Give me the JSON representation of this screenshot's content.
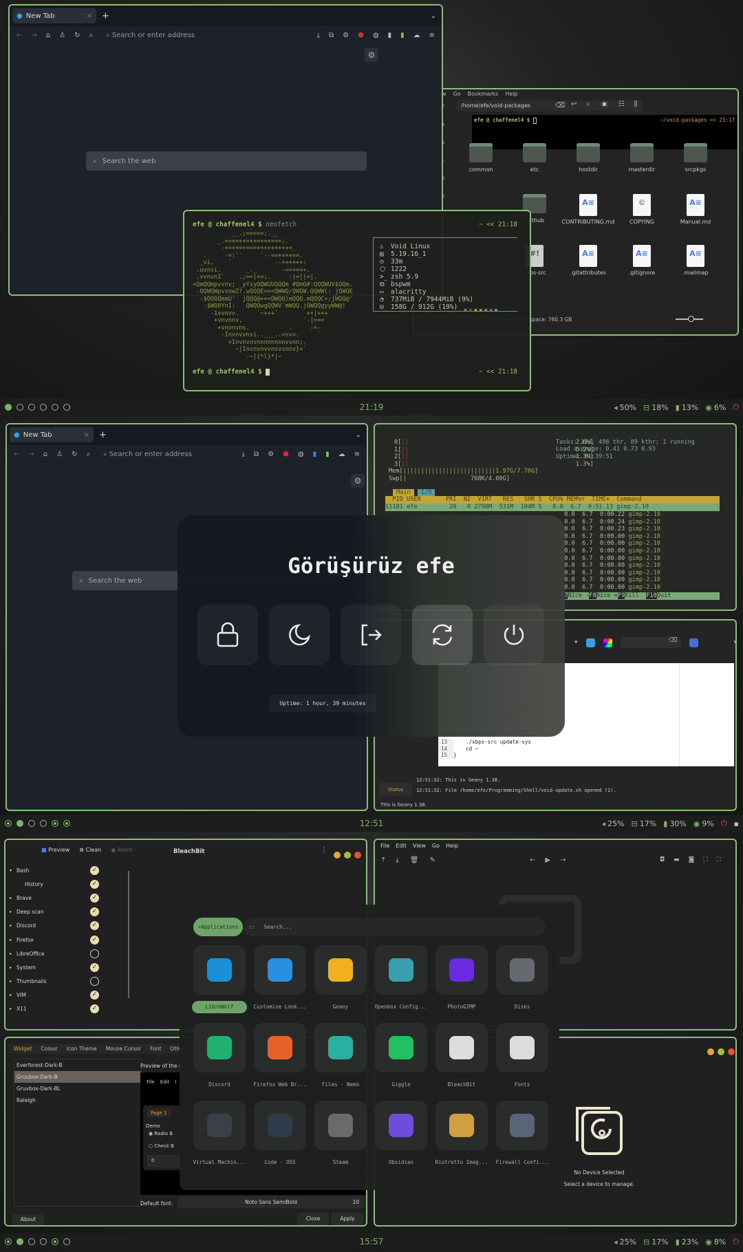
{
  "screen1": {
    "browser": {
      "tab": "New Tab",
      "address_placeholder": "Search or enter address",
      "search_placeholder": "Search the web"
    },
    "fm": {
      "menu": [
        "w",
        "Go",
        "Bookmarks",
        "Help"
      ],
      "path": "/home/efe/void-packages",
      "sidebar": [
        "ter",
        "op",
        "ites",
        "rst...",
        "s",
        "oads"
      ],
      "term_prompt": "efe @ chaffenel4 $",
      "term_right": "~/void-packages  << 21:17",
      "items": [
        {
          "name": "common",
          "type": "folder"
        },
        {
          "name": "etc",
          "type": "folder"
        },
        {
          "name": "hostdir",
          "type": "folder"
        },
        {
          "name": "masterdir",
          "type": "folder"
        },
        {
          "name": "srcpkgs",
          "type": "folder"
        },
        {
          "name": "",
          "type": "hidden"
        },
        {
          "name": ".github",
          "type": "folder"
        },
        {
          "name": "CONTRIBUTING.md",
          "type": "doc"
        },
        {
          "name": "COPYING",
          "type": "copy"
        },
        {
          "name": "Manual.md",
          "type": "doc"
        },
        {
          "name": "",
          "type": "hidden"
        },
        {
          "name": "xbps-src",
          "type": "sh"
        },
        {
          "name": ".gitattributes",
          "type": "doc"
        },
        {
          "name": ".gitignore",
          "type": "doc"
        },
        {
          "name": ".mailmap",
          "type": "doc"
        }
      ],
      "status": "16 items, Free space: 760.3 GB"
    },
    "term": {
      "prompt": "efe @ chaffenel4 $",
      "cmd": "neofetch",
      "right": "~  << 21:18",
      "art": [
        "           __.;=====;.__",
        "       _.=+==++=++=+=+===;.",
        "        -=+++=+===+=+=+++++=_",
        "   .     -=:``     `--==+=++==.",
        "  _vi,    `            --+=++++:",
        " .uvnvi.       _._       -==+==+.",
        " .vvnvnI`    .;==|==;.     :|=||=|.",
        "+QmQQmpvvnv; _yYsyQQWUUQQQm #QmQ#:QQQWUV$QQm.",
        " -QQWQWpvvowZ?.wQQQE==<QWWQ/QWQW.QQWW(: jQWQE",
        "  -$QQQQmmU'  jQQQ@+=<QWQQ)mQQQ.mQQQC+;jWQQ@'",
        "   -$WQ8YnI:   QWQQwgQQWV`mWQQ.jQWQQgyyWW@!",
        "     -1vvnvv.     `~+++`        ++|+++",
        "      +vnvnnv,                 `-|===",
        "       +vnvnvns.           .     :=-",
        "        -Invnvvnsi..___..=sv=.     `",
        "          +Invnvnvnnnnnnnnvvnn;.",
        "            ~|Invnvnvvnvvvnnv}+`",
        "               -~|{*l}*|~"
      ],
      "info": [
        "Void Linux",
        "5.19.16_1",
        "33m",
        "1222",
        "zsh 5.9",
        "bspwm",
        "alacritty",
        "737MiB / 7944MiB (9%)",
        "158G / 912G (19%)"
      ],
      "info_icons": [
        "penguin-icon",
        "kernel-icon",
        "clock-icon",
        "package-icon",
        "shell-icon",
        "wm-icon",
        "terminal-icon",
        "memory-icon",
        "disk-icon"
      ],
      "palette": [
        "#888888",
        "#cc3333",
        "#a9b33a",
        "#d79921",
        "#6aa6a6",
        "#b16286",
        "#7fa88a"
      ],
      "prompt2": "efe @ chaffenel4 $",
      "right2": "~  << 21:18"
    },
    "bar": {
      "clock": "21:19",
      "volume": "50%",
      "disk": "18%",
      "battery": "13%",
      "cpu": "6%",
      "workspaces": [
        "on",
        "",
        "",
        "",
        "",
        ""
      ]
    }
  },
  "screen2": {
    "browser": {
      "tab": "New Tab",
      "address_placeholder": "Search or enter address",
      "search_placeholder": "Search the web"
    },
    "htop": {
      "cpus": [
        {
          "id": "0",
          "pct": "2.6%"
        },
        {
          "id": "1",
          "pct": "5.2%"
        },
        {
          "id": "2",
          "pct": "1.3%"
        },
        {
          "id": "3",
          "pct": "1.3%"
        }
      ],
      "mem": "1.97G/7.76G",
      "swp": "768K/4.00G",
      "tasks": "Tasks: 114, 498 thr, 89 kthr; 1 running",
      "load": "Load average: 0.41 0.73 0.93",
      "uptime": "Uptime: 01:39:51",
      "tabs": [
        "Main",
        "I/O"
      ],
      "header": "  PID USER       PRI  NI  VIRT   RES   SHR S  CPU% MEM%▽  TIME+  Command",
      "first_row": "11181 efe         20   0 2798M  531M  104M S   0.0  6.7  0:51.13 gimp-2.10",
      "rows": [
        {
          "cpu": "0.0",
          "mem": "6.7",
          "time": "0:00.22",
          "cmd": "gimp-2.10"
        },
        {
          "cpu": "0.0",
          "mem": "6.7",
          "time": "0:00.24",
          "cmd": "gimp-2.10"
        },
        {
          "cpu": "0.0",
          "mem": "6.7",
          "time": "0:00.23",
          "cmd": "gimp-2.10"
        },
        {
          "cpu": "0.0",
          "mem": "6.7",
          "time": "0:00.00",
          "cmd": "gimp-2.10"
        },
        {
          "cpu": "0.0",
          "mem": "6.7",
          "time": "0:00.00",
          "cmd": "gimp-2.10"
        },
        {
          "cpu": "0.0",
          "mem": "6.7",
          "time": "0:00.00",
          "cmd": "gimp-2.10"
        },
        {
          "cpu": "0.0",
          "mem": "6.7",
          "time": "0:00.00",
          "cmd": "gimp-2.10"
        },
        {
          "cpu": "0.0",
          "mem": "6.7",
          "time": "0:00.00",
          "cmd": "gimp-2.10"
        },
        {
          "cpu": "0.0",
          "mem": "6.7",
          "time": "0:00.00",
          "cmd": "gimp-2.10"
        },
        {
          "cpu": "0.0",
          "mem": "6.7",
          "time": "0:00.00",
          "cmd": "gimp-2.10"
        },
        {
          "cpu": "0.0",
          "mem": "6.7",
          "time": "0:00.00",
          "cmd": "gimp-2.10"
        }
      ],
      "footer": [
        {
          "k": "F7",
          "v": "Nice -"
        },
        {
          "k": "F8",
          "v": "Nice +"
        },
        {
          "k": "F9",
          "v": "Kill  "
        },
        {
          "k": "F10",
          "v": "Quit"
        }
      ]
    },
    "geany": {
      "code": [
        {
          "n": "13",
          "t": "    ./xbps-src update-sys"
        },
        {
          "n": "14",
          "t": "    cd ~"
        },
        {
          "n": "15",
          "t": "}"
        }
      ],
      "strings": [
        "............\"",
        "tılıyor...\"",
        "............\""
      ],
      "messages": [
        "12:51:32: This is Geany 1.38.",
        "12:51:32: File /home/efe/Programming/Shell/void-update.sh opened (1)."
      ],
      "status_tab": "Status",
      "statusbar": "This is Geany 1.38."
    },
    "logout": {
      "title": "Görüşürüz efe",
      "uptime": "Uptime: 1 hour, 39 minutes",
      "buttons": [
        "lock",
        "suspend",
        "logout",
        "reboot",
        "shutdown"
      ],
      "active": "reboot"
    },
    "bar": {
      "clock": "12:51",
      "volume": "25%",
      "disk": "17%",
      "battery": "30%",
      "cpu": "9%"
    }
  },
  "screen3": {
    "bleachbit": {
      "title": "BleachBit",
      "preview": "Preview",
      "clean": "Clean",
      "abort": "Abort",
      "items": [
        {
          "name": "Bash",
          "checked": true,
          "expanded": true
        },
        {
          "name": "History",
          "checked": true,
          "child": true
        },
        {
          "name": "Brave",
          "checked": true
        },
        {
          "name": "Deep scan",
          "checked": true
        },
        {
          "name": "Discord",
          "checked": true
        },
        {
          "name": "Firefox",
          "checked": true
        },
        {
          "name": "LibreOffice",
          "checked": false
        },
        {
          "name": "System",
          "checked": true
        },
        {
          "name": "Thumbnails",
          "checked": false
        },
        {
          "name": "VIM",
          "checked": true
        },
        {
          "name": "X11",
          "checked": true
        }
      ]
    },
    "viewer": {
      "menu": [
        "File",
        "Edit",
        "View",
        "Go",
        "Help"
      ]
    },
    "theme": {
      "tabs": [
        "Widget",
        "Colour",
        "Icon Theme",
        "Mouse Cursor",
        "Font",
        "Other"
      ],
      "themes": [
        "Everforest-Dark-B",
        "Gruvbox-Dark-B",
        "Gruvbox-Dark-BL",
        "Raleigh"
      ],
      "selected": 1,
      "preview_label": "Preview of the se",
      "preview_menu": [
        "File",
        "Edit",
        "I"
      ],
      "page_tab": "Page 1",
      "demo": "Demo",
      "radio": "Radio B",
      "check": "Check B",
      "spin": "0",
      "font_label": "Default font:",
      "font": "Noto Sans SemiBold",
      "font_size": "10",
      "close": "Close",
      "apply": "Apply",
      "about": "About"
    },
    "device": {
      "title": "No Device Selected",
      "subtitle": "Select a device to manage."
    },
    "launcher": {
      "mode": "Applications",
      "sep": "::",
      "placeholder": "Search...",
      "apps": [
        {
          "name": "LibreWolf",
          "color": "#1d8fd8"
        },
        {
          "name": "Customise Look...",
          "color": "#2b8fe0"
        },
        {
          "name": "Geany",
          "color": "#f0b020"
        },
        {
          "name": "Openbox Config...",
          "color": "#3aa0b0"
        },
        {
          "name": "PhotoGIMP",
          "color": "#6a2be0"
        },
        {
          "name": "Disks",
          "color": "#666a70"
        },
        {
          "name": "Discord",
          "color": "#22b070"
        },
        {
          "name": "Firefox Web Br...",
          "color": "#e8602a"
        },
        {
          "name": "Files - Nemo",
          "color": "#2ab0a0"
        },
        {
          "name": "Giggle",
          "color": "#22c060"
        },
        {
          "name": "BleachBit",
          "color": "#dddddd"
        },
        {
          "name": "Fonts",
          "color": "#dcdcdc"
        },
        {
          "name": "Virtual Machin...",
          "color": "#3a3f48"
        },
        {
          "name": "Code - OSS",
          "color": "#2f3b4a"
        },
        {
          "name": "Steam",
          "color": "#6a6a6a"
        },
        {
          "name": "Obsidian",
          "color": "#6e4ed8"
        },
        {
          "name": "Ristretto Imag...",
          "color": "#d0a040"
        },
        {
          "name": "Firewall Confi...",
          "color": "#5a6478"
        }
      ],
      "selected": 0
    },
    "bar": {
      "clock": "15:57",
      "volume": "25%",
      "disk": "17%",
      "battery": "23%",
      "cpu": "8%"
    }
  },
  "colors": {
    "accent": "#8cbf7a",
    "bar_green": "#7fb36b",
    "power": "#e05050"
  }
}
